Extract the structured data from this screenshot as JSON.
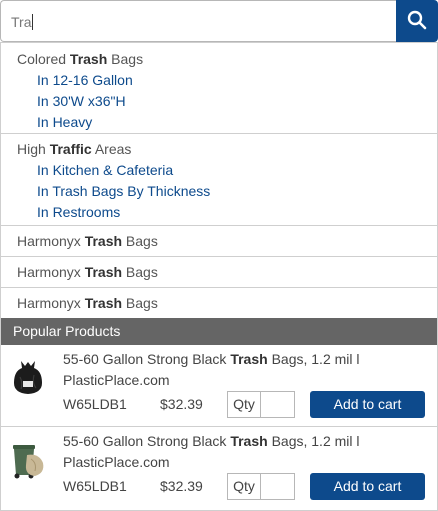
{
  "search": {
    "value": "Tra",
    "button_icon": "search-icon"
  },
  "colors": {
    "accent": "#0d4a8c",
    "header_bg": "#656565"
  },
  "suggestions": {
    "group1": {
      "prefix": "Colored ",
      "match": "Trash",
      "suffix": " Bags",
      "items": [
        "In 12-16 Gallon",
        "In 30'W x36\"H",
        "In Heavy"
      ]
    },
    "group2": {
      "prefix": "High ",
      "match": "Traffic",
      "suffix": " Areas",
      "items": [
        "In Kitchen & Cafeteria",
        "In Trash Bags By Thickness",
        "In Restrooms"
      ]
    },
    "rows": [
      {
        "prefix": "Harmonyx ",
        "match": "Trash",
        "suffix": " Bags"
      },
      {
        "prefix": "Harmonyx ",
        "match": "Trash",
        "suffix": " Bags"
      },
      {
        "prefix": "Harmonyx ",
        "match": "Trash",
        "suffix": " Bags"
      }
    ]
  },
  "popular": {
    "title": "Popular Products",
    "products": [
      {
        "name_prefix": "55-60 Gallon Strong Black ",
        "name_match": "Trash",
        "name_suffix": " Bags, 1.2 mil l PlasticPlace.com",
        "sku": "W65LDB1",
        "price": "$32.39",
        "qty_label": "Qty",
        "qty_value": "",
        "add_label": "Add to cart",
        "thumb_icon": "black-trash-bag-icon"
      },
      {
        "name_prefix": "55-60 Gallon Strong Black ",
        "name_match": "Trash",
        "name_suffix": " Bags, 1.2 mil l PlasticPlace.com",
        "sku": "W65LDB1",
        "price": "$32.39",
        "qty_label": "Qty",
        "qty_value": "",
        "add_label": "Add to cart",
        "thumb_icon": "trash-can-with-bag-icon"
      }
    ]
  }
}
